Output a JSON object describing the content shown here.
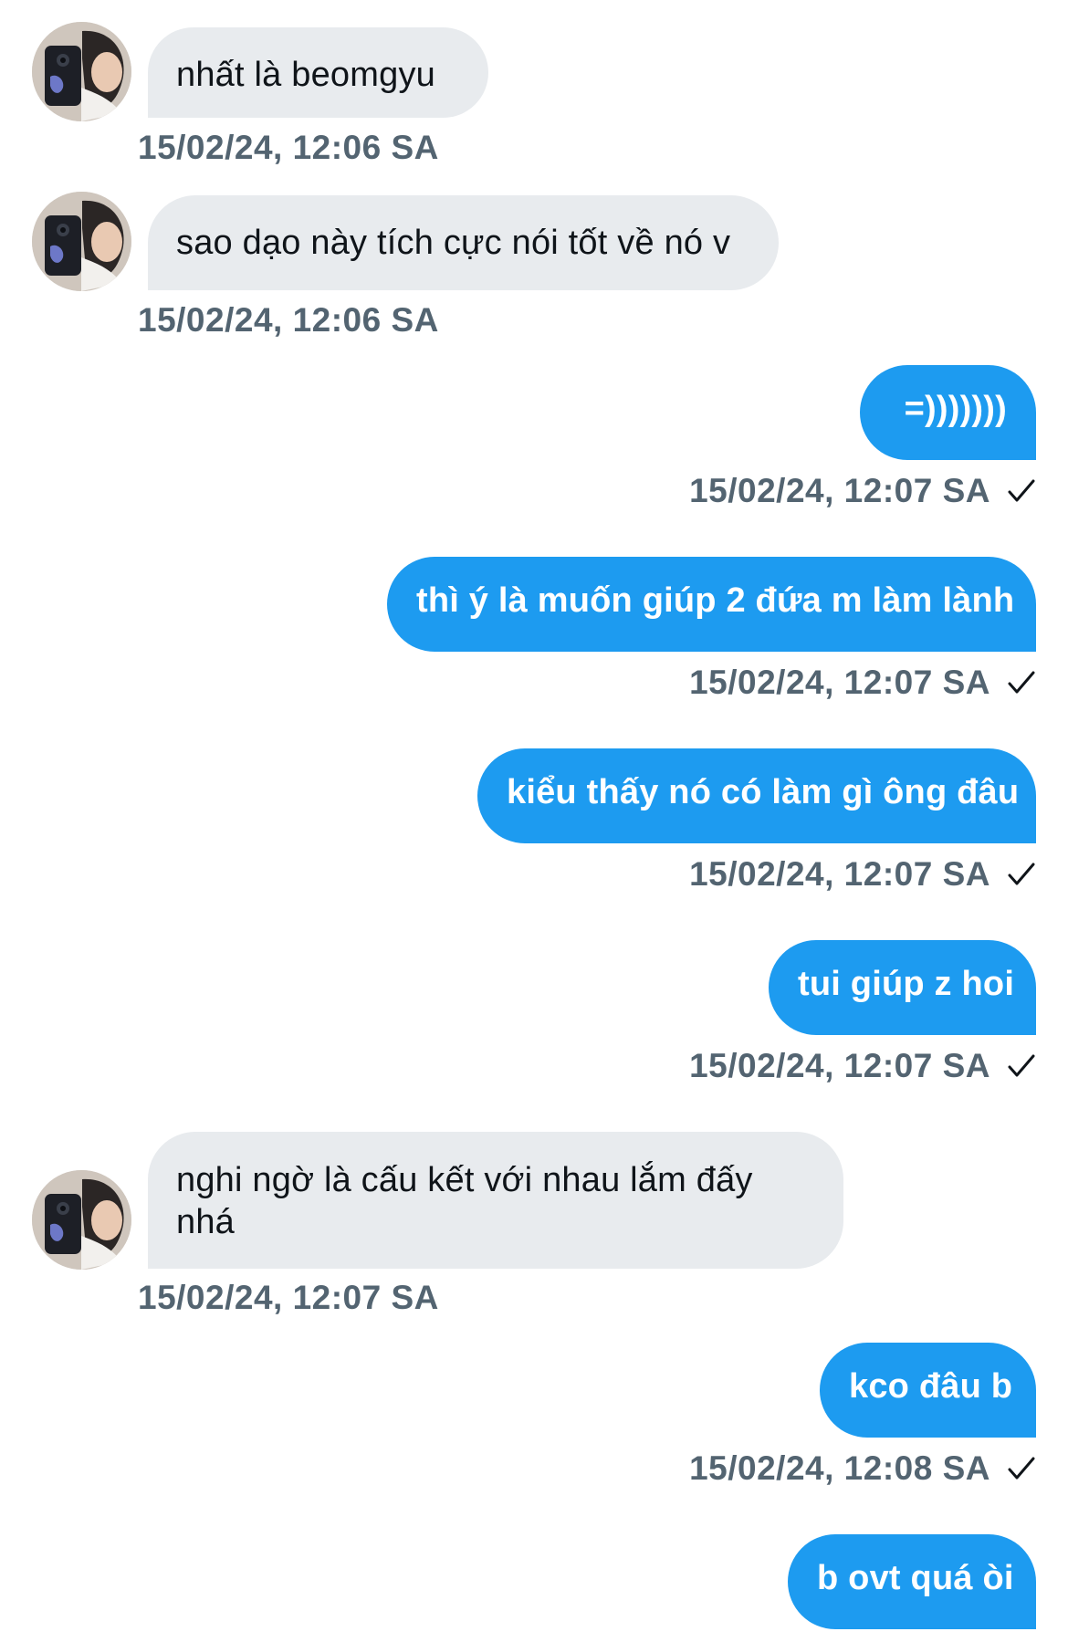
{
  "messages": [
    {
      "direction": "in",
      "text": "nhất là beomgyu",
      "time": "15/02/24, 12:06 SA"
    },
    {
      "direction": "in",
      "text": "sao dạo này tích cực nói tốt về nó v",
      "time": "15/02/24, 12:06 SA"
    },
    {
      "direction": "out",
      "text": "=)))))))",
      "time": "15/02/24, 12:07 SA",
      "status_icon": "check-icon"
    },
    {
      "direction": "out",
      "text": "thì ý là muốn giúp 2 đứa m làm lành",
      "time": "15/02/24, 12:07 SA",
      "status_icon": "check-icon"
    },
    {
      "direction": "out",
      "text": "kiểu thấy nó có làm gì ông đâu",
      "time": "15/02/24, 12:07 SA",
      "status_icon": "check-icon"
    },
    {
      "direction": "out",
      "text": "tui giúp z hoi",
      "time": "15/02/24, 12:07 SA",
      "status_icon": "check-icon"
    },
    {
      "direction": "in",
      "text": "nghi ngờ là cấu kết với nhau lắm đấy nhá",
      "time": "15/02/24, 12:07 SA"
    },
    {
      "direction": "out",
      "text": "kco đâu b",
      "time": "15/02/24, 12:08 SA",
      "status_icon": "check-icon"
    },
    {
      "direction": "out",
      "text": "b ovt quá òi",
      "time": "",
      "status_icon": ""
    }
  ],
  "colors": {
    "incoming_bubble": "#e8ebee",
    "outgoing_bubble": "#1d9bf0",
    "timestamp": "#536471"
  }
}
